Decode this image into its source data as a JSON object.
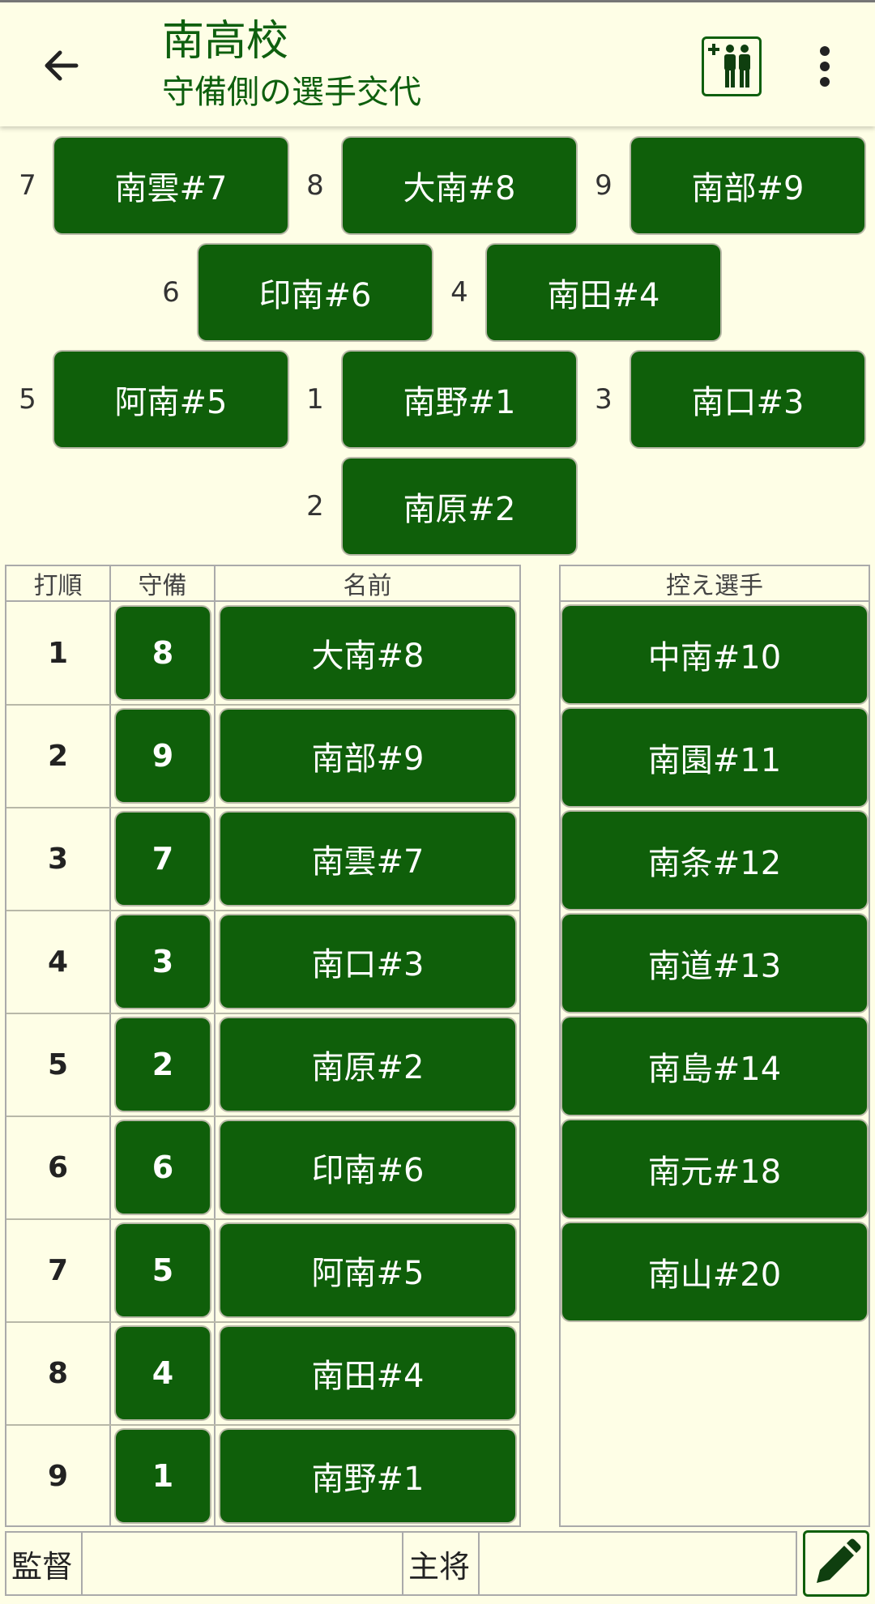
{
  "header": {
    "team_name": "南高校",
    "subtitle": "守備側の選手交代"
  },
  "field": {
    "positions": [
      {
        "num": "7",
        "player": "南雲#7"
      },
      {
        "num": "8",
        "player": "大南#8"
      },
      {
        "num": "9",
        "player": "南部#9"
      },
      {
        "num": "6",
        "player": "印南#6"
      },
      {
        "num": "4",
        "player": "南田#4"
      },
      {
        "num": "5",
        "player": "阿南#5"
      },
      {
        "num": "1",
        "player": "南野#1"
      },
      {
        "num": "3",
        "player": "南口#3"
      },
      {
        "num": "2",
        "player": "南原#2"
      }
    ]
  },
  "lineup": {
    "headers": {
      "order": "打順",
      "position": "守備",
      "name": "名前"
    },
    "rows": [
      {
        "order": "1",
        "position": "8",
        "name": "大南#8"
      },
      {
        "order": "2",
        "position": "9",
        "name": "南部#9"
      },
      {
        "order": "3",
        "position": "7",
        "name": "南雲#7"
      },
      {
        "order": "4",
        "position": "3",
        "name": "南口#3"
      },
      {
        "order": "5",
        "position": "2",
        "name": "南原#2"
      },
      {
        "order": "6",
        "position": "6",
        "name": "印南#6"
      },
      {
        "order": "7",
        "position": "5",
        "name": "阿南#5"
      },
      {
        "order": "8",
        "position": "4",
        "name": "南田#4"
      },
      {
        "order": "9",
        "position": "1",
        "name": "南野#1"
      }
    ]
  },
  "bench": {
    "header": "控え選手",
    "players": [
      "中南#10",
      "南園#11",
      "南条#12",
      "南道#13",
      "南島#14",
      "南元#18",
      "南山#20"
    ]
  },
  "footer": {
    "manager_label": "監督",
    "manager_value": "",
    "captain_label": "主将",
    "captain_value": ""
  },
  "colors": {
    "accent": "#0f5f0a",
    "background": "#fefee6",
    "title": "#0e5f0e"
  },
  "icons": {
    "back": "arrow-left",
    "substitute": "add-people",
    "menu": "more-vertical",
    "edit": "pencil"
  }
}
